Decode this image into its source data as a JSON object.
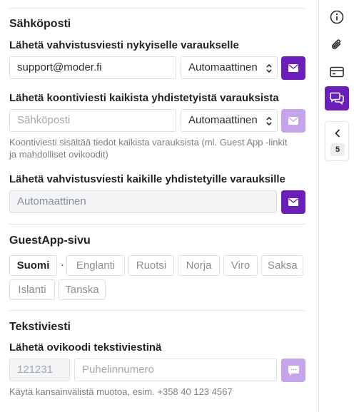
{
  "email_section": {
    "title": "Sähköposti",
    "confirm_current": {
      "label": "Lähetä vahvistusviesti nykyiselle varaukselle",
      "email_value": "support@moder.fi",
      "language_select": "Automaattinen"
    },
    "summary": {
      "label": "Lähetä koontiviesti kaikista yhdistetyistä varauksista",
      "email_placeholder": "Sähköposti",
      "language_select": "Automaattinen",
      "hint": "Koontiviesti sisältää tiedot kaikista varauksista (ml. Guest App -linkit ja mahdolliset ovikoodit)"
    },
    "confirm_all": {
      "label": "Lähetä vahvistusviesti kaikille yhdistetyille varauksille",
      "value": "Automaattinen"
    }
  },
  "guestapp_section": {
    "title": "GuestApp-sivu",
    "languages": [
      "Suomi",
      "Englanti",
      "Ruotsi",
      "Norja",
      "Viro",
      "Saksa",
      "Islanti",
      "Tanska"
    ],
    "selected": "Suomi"
  },
  "sms_section": {
    "title": "Tekstiviesti",
    "label": "Lähetä ovikoodi tekstiviestinä",
    "code_placeholder": "121231",
    "phone_placeholder": "Puhelinnumero",
    "hint": "Käytä kansainvälistä muotoa, esim. +358 40 123 4567"
  },
  "sidebar": {
    "icons": [
      "info-icon",
      "paperclip-icon",
      "payment-card-icon",
      "chat-icon",
      "chevron-left-icon"
    ],
    "collapsed_count": "5"
  },
  "colors": {
    "accent": "#6a1fb8",
    "accent_disabled": "#c5a5ea"
  }
}
